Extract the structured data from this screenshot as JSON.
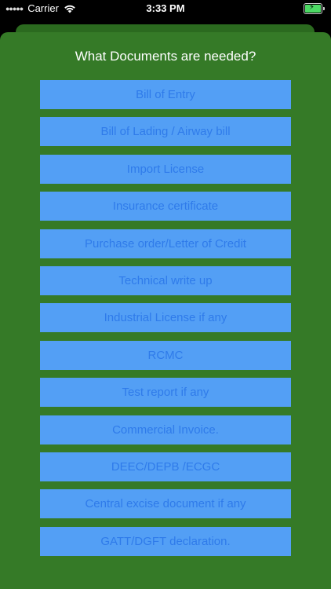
{
  "status_bar": {
    "carrier": "Carrier",
    "time": "3:33 PM"
  },
  "title": "What Documents are needed?",
  "colors": {
    "background": "#357a27",
    "button_bg": "#539ff5",
    "button_text": "#2f7bea"
  },
  "documents": [
    "Bill of Entry",
    "Bill of Lading / Airway bill",
    "Import License",
    "Insurance certificate",
    "Purchase order/Letter of Credit",
    "Technical write up",
    "Industrial License if any",
    "RCMC",
    "Test report if any",
    "Commercial Invoice.",
    "DEEC/DEPB /ECGC",
    "Central excise document if any",
    "GATT/DGFT declaration."
  ]
}
